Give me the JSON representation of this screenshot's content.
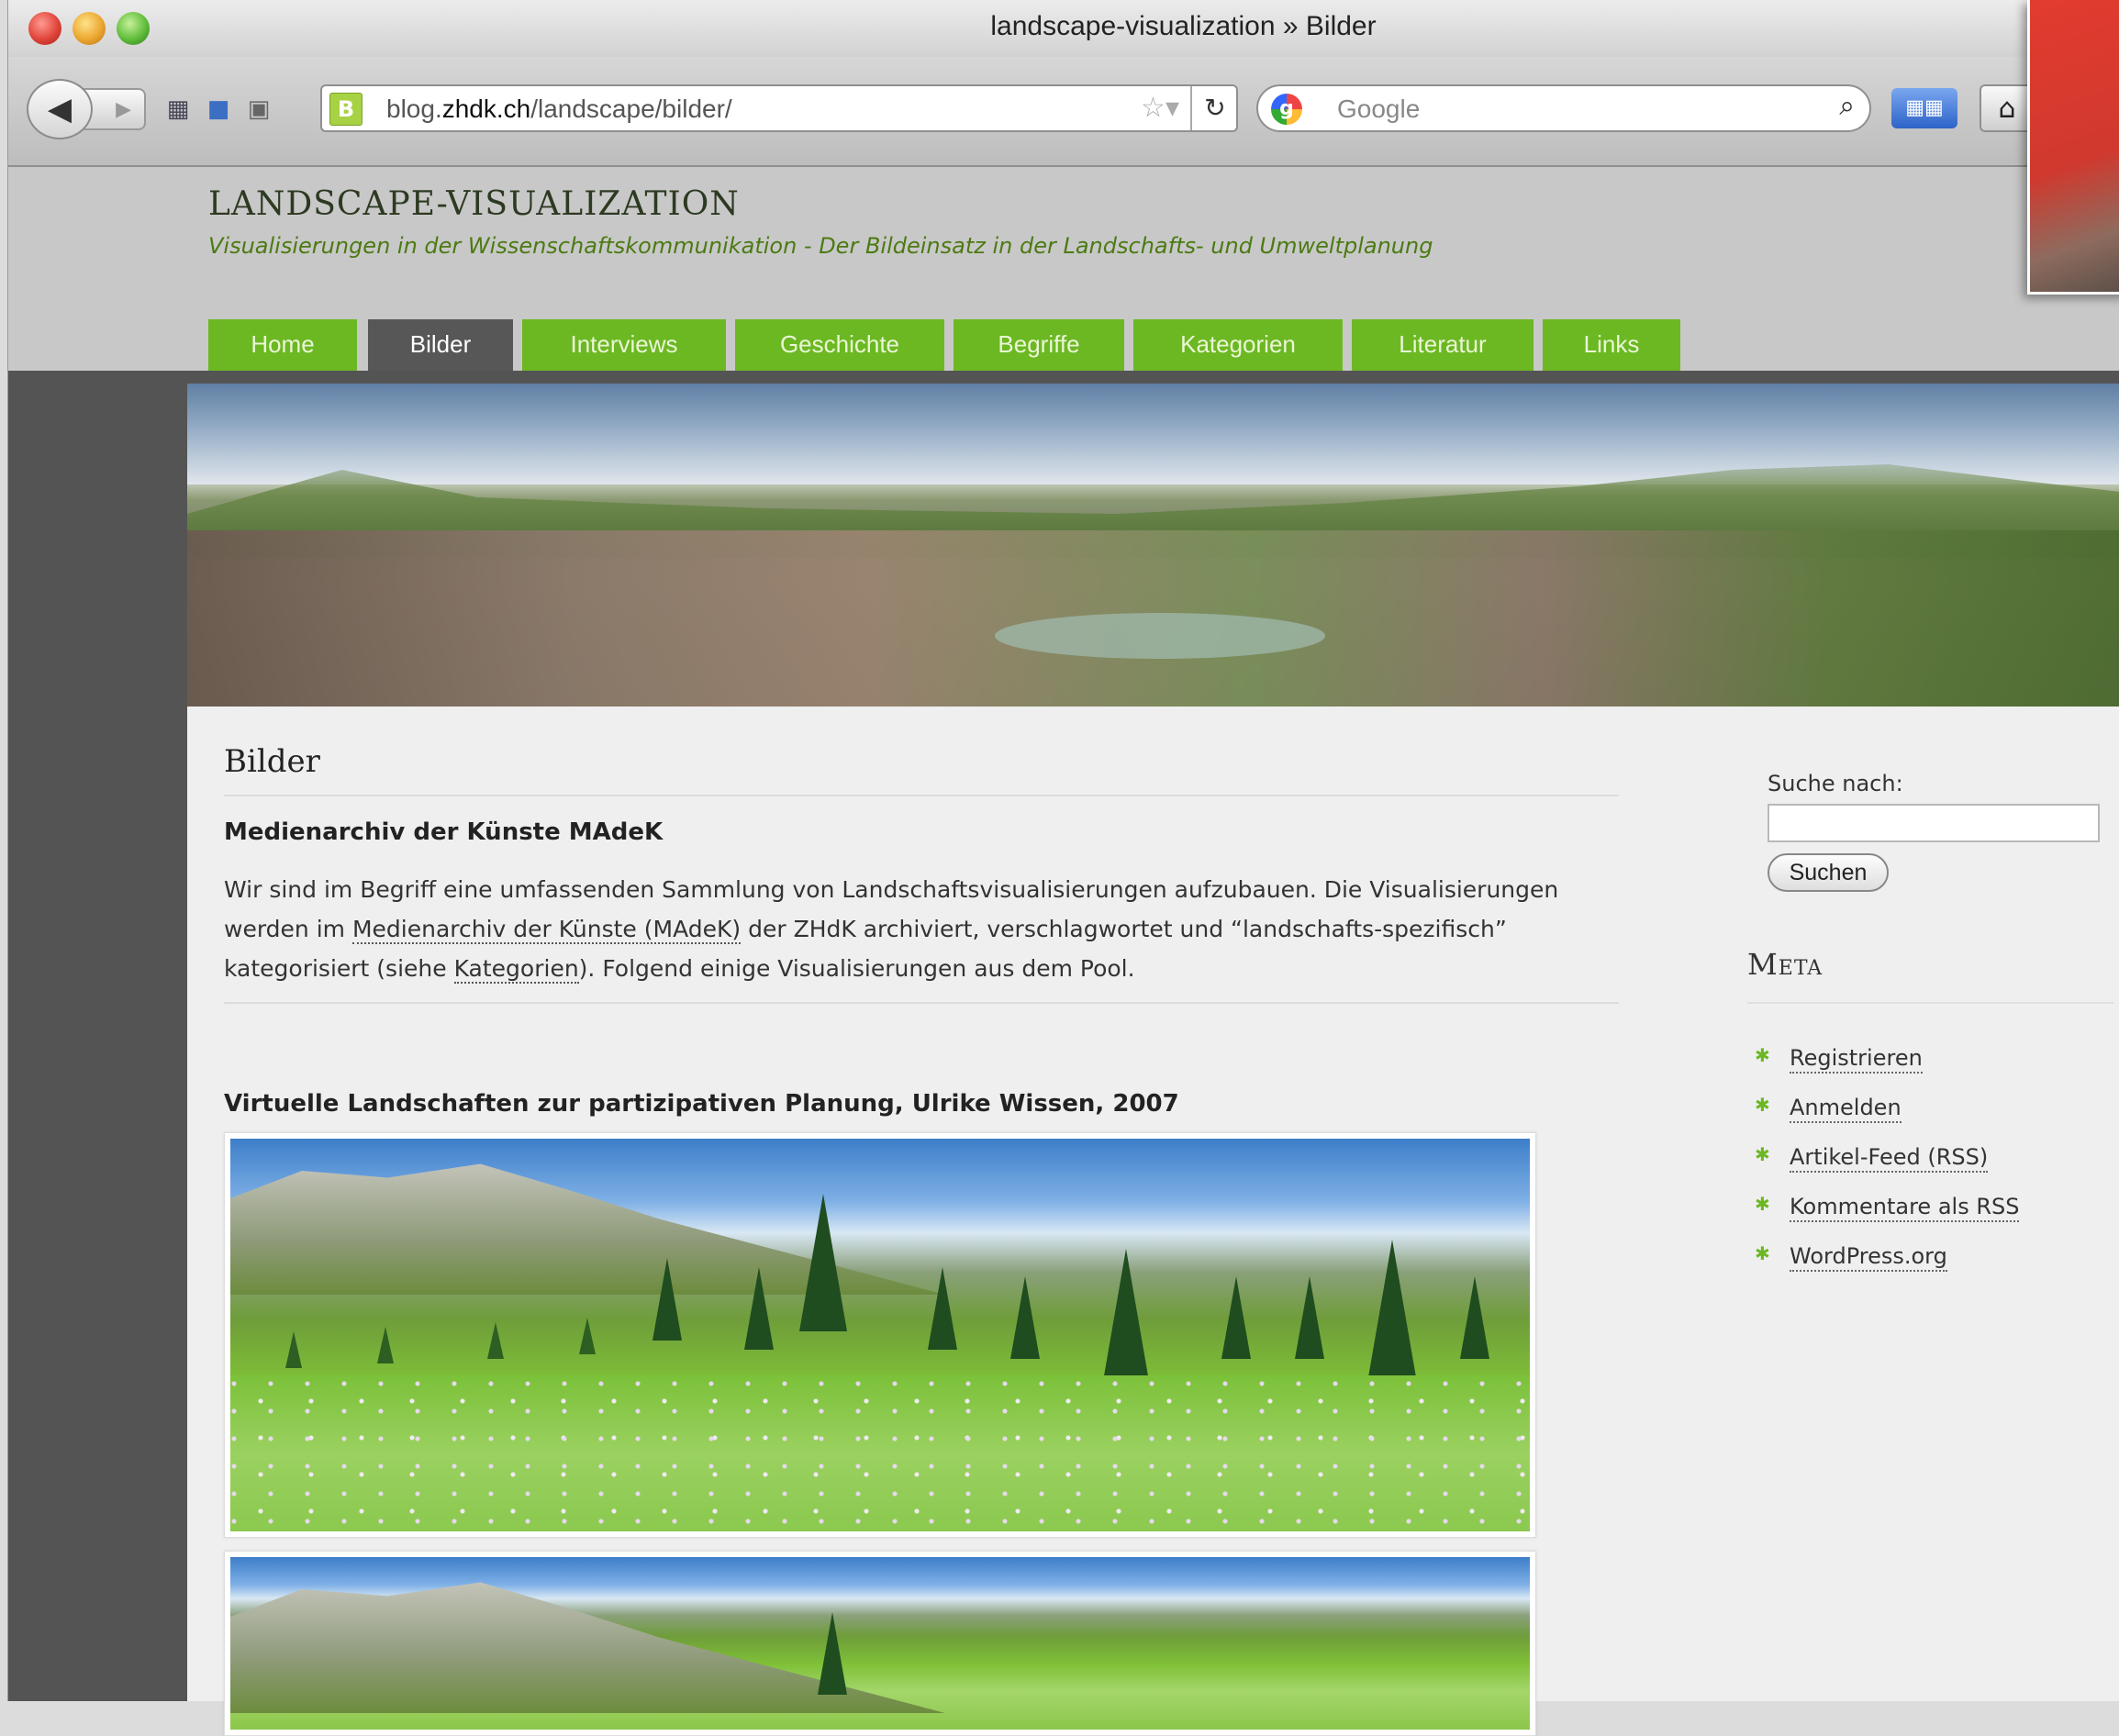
{
  "browser": {
    "window_title": "landscape-visualization » Bilder",
    "url_prefix": "blog.",
    "url_domain": "zhdk.ch",
    "url_path": "/landscape/bilder/",
    "search_placeholder": "Google",
    "favicon_letter": "B"
  },
  "site": {
    "title": "LANDSCAPE-VISUALIZATION",
    "tagline": "Visualisierungen in der Wissenschaftskommunikation - Der Bildeinsatz in der Landschafts- und Umweltplanung"
  },
  "nav": [
    {
      "label": "Home"
    },
    {
      "label": "Bilder"
    },
    {
      "label": "Interviews"
    },
    {
      "label": "Geschichte"
    },
    {
      "label": "Begriffe"
    },
    {
      "label": "Kategorien"
    },
    {
      "label": "Literatur"
    },
    {
      "label": "Links"
    }
  ],
  "nav_active": "Bilder",
  "main": {
    "page_title": "Bilder",
    "section1_heading": "Medienarchiv der Künste MAdeK",
    "para_part1": "Wir sind im Begriff eine umfassenden Sammlung von Landschaftsvisualisierungen aufzubauen. Die Visualisierungen werden im ",
    "para_link1": "Medienarchiv der Künste (MAdeK)",
    "para_part2": " der ZHdK archiviert, verschlagwortet und “landschafts-spezifisch” kategorisiert (siehe ",
    "para_link2": "Kategorien",
    "para_part3": "). Folgend einige Visualisierungen aus dem Pool.",
    "section2_heading": "Virtuelle Landschaften zur partizipativen Planung, Ulrike Wissen, 2007"
  },
  "sidebar": {
    "search_label": "Suche nach:",
    "search_button": "Suchen",
    "meta_heading": "Meta",
    "meta_links": [
      {
        "label": "Registrieren"
      },
      {
        "label": "Anmelden"
      },
      {
        "label": "Artikel-Feed (RSS)"
      },
      {
        "label": "Kommentare als RSS"
      },
      {
        "label": "WordPress.org"
      }
    ]
  },
  "icons": {
    "back": "back-arrow-icon",
    "forward": "forward-arrow-icon",
    "reload": "reload-icon",
    "star": "bookmark-star-icon",
    "search": "magnifier-icon",
    "home": "home-icon",
    "bookmarks": "bookmarks-grid-icon"
  },
  "colors": {
    "nav_green": "#6cb823",
    "nav_active": "#575757",
    "tagline_green": "#4c7a12"
  }
}
